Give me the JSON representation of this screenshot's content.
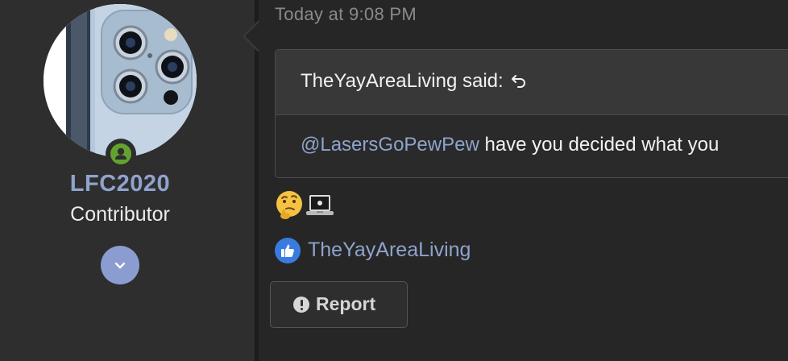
{
  "user": {
    "username": "LFC2020",
    "title": "Contributor",
    "avatar": "phone-camera-avatar",
    "online_color": "#62a32e",
    "username_color": "#8fa3cc"
  },
  "post": {
    "date": "Today at 9:08 PM",
    "quote": {
      "author_line": "TheYayAreaLiving said:",
      "mention": "@LasersGoPewPew",
      "text": " have you decided what you"
    },
    "emojis": [
      "thinking-face-emoji",
      "laptop-emoji"
    ],
    "reactions": {
      "icon": "thumbs-up-icon",
      "users": "TheYayAreaLiving",
      "icon_color": "#3a7be0"
    },
    "actions": {
      "report_label": "Report"
    }
  }
}
